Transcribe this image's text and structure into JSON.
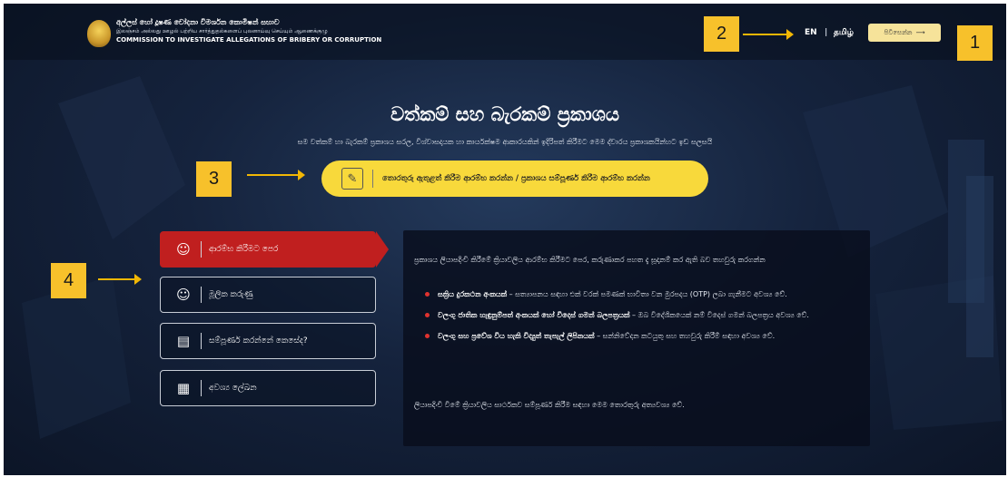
{
  "header": {
    "org_line1": "අල්ලස් හෝ දූෂණ චෝදනා විමර්ශන කොමිෂන් සභාව",
    "org_line2": "இலஞ்சம் அல்லது ஊழல் பற்றிய சார்த்துதல்களைப் புலனாய்வு செய்யும் ஆணைக்குழு",
    "org_line3": "COMMISSION TO INVESTIGATE ALLEGATIONS OF BRIBERY OR CORRUPTION",
    "lang_en": "EN",
    "lang_sep": "|",
    "lang_ta": "தமிழ்",
    "login_label": "පිවිසෙන්න",
    "login_arrow": "⟶"
  },
  "main": {
    "title": "වත්කම් සහ බැරකම් ප්‍රකාශය",
    "subtitle": "සම වත්කම් හා බැරකම් ප්‍රකාශය සරල, විශ්වාසදායක හා කාර්යක්ෂම ආකාරයකින් ඉදිරිපත් කිරීමට මෙම ද්වාරය ප්‍රකාශකයින්හට ඉඩ සලසයි",
    "cta_label": "තොරතුරු ඇතුළත් කිරීම ආරම්භ කරන්න / ප්‍රකාශය සම්පූර්ණ කිරීම ආරම්භ කරන්න"
  },
  "menu": [
    {
      "label": "ආරම්භ කිරීමට පෙර",
      "icon": "people-icon",
      "glyph": "☺"
    },
    {
      "label": "මූලික කරුණු",
      "icon": "people-icon",
      "glyph": "☺"
    },
    {
      "label": "සම්පූර්ණ කරන්නේ කෙසේද?",
      "icon": "document-icon",
      "glyph": "▤"
    },
    {
      "label": "අවශ්‍ය ලේඛන",
      "icon": "calculator-icon",
      "glyph": "▦"
    }
  ],
  "panel": {
    "intro": "ප්‍රකාශය ලියාපදිංචි කිරීමේ ක්‍රියාවලිය ආරම්භ කිරීමට පෙර, කරුණාකර පහත දැ සූදානම් කර ඇති බව තහවුරු කරගන්න",
    "items": [
      {
        "bold": "සක්‍රිය දුරකථන අංකයක්",
        "text": " – සත්‍යාපනය සඳහා එක් වරක් පමණක් භාවිතා වන මුරපදය (OTP) ලබා ගැනීමට අවශ්‍ය වේ."
      },
      {
        "bold": "වලංගු ජාතික හැඳුනුම්පත් අංකයක් හෝ විදෙස් ගමන් බලපත්‍රයක්",
        "text": " – ඔබ විදේශිකයෙක් නම් විදෙස් ගමන් බලපත්‍රය අවශ්‍ය වේ."
      },
      {
        "bold": "වලංගු සහ ප්‍රවේශ විය හැකි විද්‍යුත් තැපැල් ලිපිනයක්",
        "text": " – සන්නිවේදන කටයුතු සහ තහවුරු කිරීම් සඳහා අවශ්‍ය වේ."
      }
    ],
    "outro": "ලියාපදිංචි වීමේ ක්‍රියාවලිය සාර්ථකව සම්පූර්ණ කිරීම සඳහා මෙම තොරතුරු අත්‍යවශ්‍ය වේ."
  },
  "callouts": [
    "1",
    "2",
    "3",
    "4"
  ],
  "colors": {
    "accent_red": "#c01f1f",
    "cta_yellow": "#f8d93b",
    "callout_yellow": "#f7c12b",
    "background_navy": "#15233d"
  }
}
